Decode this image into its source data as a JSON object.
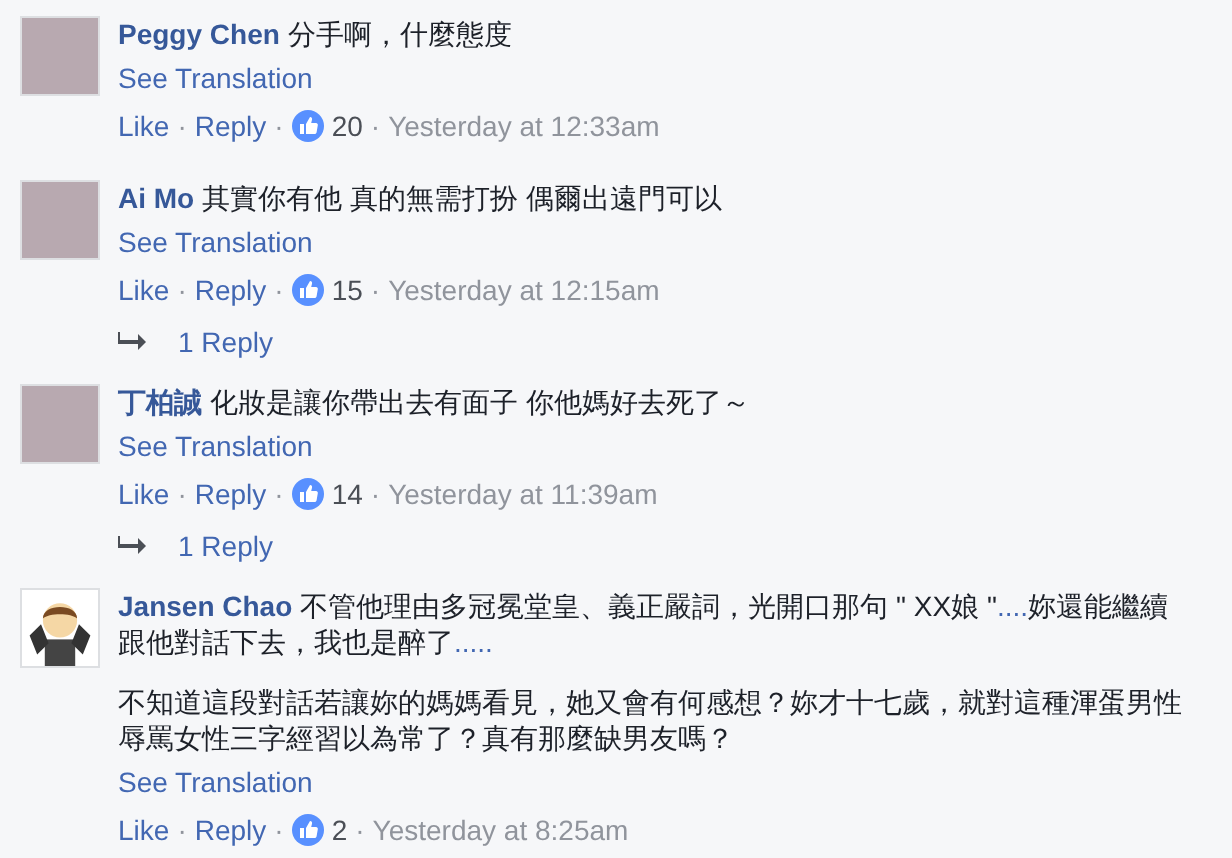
{
  "comments": [
    {
      "author": "Peggy Chen",
      "kind": "photo",
      "separators": [
        "·",
        "·",
        "·"
      ],
      "paragraphs": [
        [
          {
            "kind": "text",
            "text": "分手啊，什麼態度"
          }
        ]
      ],
      "translate": "See Translation",
      "like": "Like",
      "reply": "Reply",
      "likes": "20",
      "time": "Yesterday at 12:33am"
    },
    {
      "author": "Ai Mo",
      "kind": "photo",
      "separators": [
        "·",
        "·",
        "·"
      ],
      "paragraphs": [
        [
          {
            "kind": "text",
            "text": "其實你有他 真的無需打扮 偶爾出遠門可以"
          }
        ]
      ],
      "translate": "See Translation",
      "like": "Like",
      "reply": "Reply",
      "likes": "15",
      "time": "Yesterday at 12:15am",
      "replies": "1 Reply"
    },
    {
      "author": "丁柏誠",
      "kind": "photo",
      "separators": [
        "·",
        "·",
        "·"
      ],
      "paragraphs": [
        [
          {
            "kind": "text",
            "text": "化妝是讓你帶出去有面子 你他媽好去死了～"
          }
        ]
      ],
      "translate": "See Translation",
      "like": "Like",
      "reply": "Reply",
      "likes": "14",
      "time": "Yesterday at 11:39am",
      "replies": "1 Reply"
    },
    {
      "author": "Jansen Chao",
      "kind": "cartoon",
      "separators": [
        "·",
        "·",
        "·"
      ],
      "paragraphs": [
        [
          {
            "kind": "text",
            "text": "不管他理由多冠冕堂皇、義正嚴詞，光開口那句 \" XX娘 \""
          },
          {
            "kind": "link",
            "text": "...."
          },
          {
            "kind": "text",
            "text": "妳還能繼續跟他對話下去，我也是醉了"
          },
          {
            "kind": "link",
            "text": "....."
          }
        ],
        [
          {
            "kind": "text",
            "text": "不知道這段對話若讓妳的媽媽看見，她又會有何感想？妳才十七歲，就對這種渾蛋男性辱罵女性三字經習以為常了？真有那麼缺男友嗎？"
          }
        ]
      ],
      "translate": "See Translation",
      "like": "Like",
      "reply": "Reply",
      "likes": "2",
      "time": "Yesterday at 8:25am"
    }
  ]
}
